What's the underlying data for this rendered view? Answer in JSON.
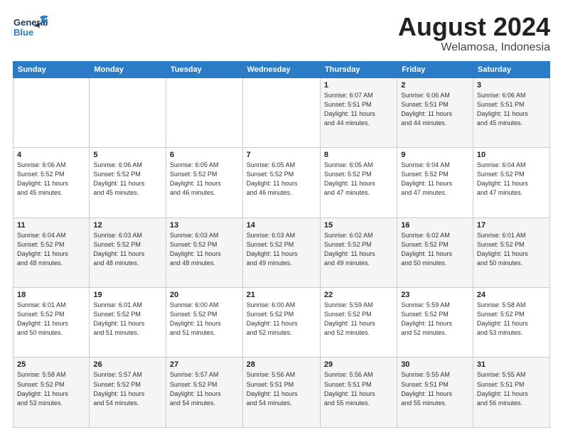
{
  "header": {
    "logo_line1": "General",
    "logo_line2": "Blue",
    "month": "August 2024",
    "location": "Welamosa, Indonesia"
  },
  "weekdays": [
    "Sunday",
    "Monday",
    "Tuesday",
    "Wednesday",
    "Thursday",
    "Friday",
    "Saturday"
  ],
  "weeks": [
    [
      {
        "day": "",
        "info": ""
      },
      {
        "day": "",
        "info": ""
      },
      {
        "day": "",
        "info": ""
      },
      {
        "day": "",
        "info": ""
      },
      {
        "day": "1",
        "info": "Sunrise: 6:07 AM\nSunset: 5:51 PM\nDaylight: 11 hours\nand 44 minutes."
      },
      {
        "day": "2",
        "info": "Sunrise: 6:06 AM\nSunset: 5:51 PM\nDaylight: 11 hours\nand 44 minutes."
      },
      {
        "day": "3",
        "info": "Sunrise: 6:06 AM\nSunset: 5:51 PM\nDaylight: 11 hours\nand 45 minutes."
      }
    ],
    [
      {
        "day": "4",
        "info": "Sunrise: 6:06 AM\nSunset: 5:52 PM\nDaylight: 11 hours\nand 45 minutes."
      },
      {
        "day": "5",
        "info": "Sunrise: 6:06 AM\nSunset: 5:52 PM\nDaylight: 11 hours\nand 45 minutes."
      },
      {
        "day": "6",
        "info": "Sunrise: 6:05 AM\nSunset: 5:52 PM\nDaylight: 11 hours\nand 46 minutes."
      },
      {
        "day": "7",
        "info": "Sunrise: 6:05 AM\nSunset: 5:52 PM\nDaylight: 11 hours\nand 46 minutes."
      },
      {
        "day": "8",
        "info": "Sunrise: 6:05 AM\nSunset: 5:52 PM\nDaylight: 11 hours\nand 47 minutes."
      },
      {
        "day": "9",
        "info": "Sunrise: 6:04 AM\nSunset: 5:52 PM\nDaylight: 11 hours\nand 47 minutes."
      },
      {
        "day": "10",
        "info": "Sunrise: 6:04 AM\nSunset: 5:52 PM\nDaylight: 11 hours\nand 47 minutes."
      }
    ],
    [
      {
        "day": "11",
        "info": "Sunrise: 6:04 AM\nSunset: 5:52 PM\nDaylight: 11 hours\nand 48 minutes."
      },
      {
        "day": "12",
        "info": "Sunrise: 6:03 AM\nSunset: 5:52 PM\nDaylight: 11 hours\nand 48 minutes."
      },
      {
        "day": "13",
        "info": "Sunrise: 6:03 AM\nSunset: 5:52 PM\nDaylight: 11 hours\nand 48 minutes."
      },
      {
        "day": "14",
        "info": "Sunrise: 6:03 AM\nSunset: 5:52 PM\nDaylight: 11 hours\nand 49 minutes."
      },
      {
        "day": "15",
        "info": "Sunrise: 6:02 AM\nSunset: 5:52 PM\nDaylight: 11 hours\nand 49 minutes."
      },
      {
        "day": "16",
        "info": "Sunrise: 6:02 AM\nSunset: 5:52 PM\nDaylight: 11 hours\nand 50 minutes."
      },
      {
        "day": "17",
        "info": "Sunrise: 6:01 AM\nSunset: 5:52 PM\nDaylight: 11 hours\nand 50 minutes."
      }
    ],
    [
      {
        "day": "18",
        "info": "Sunrise: 6:01 AM\nSunset: 5:52 PM\nDaylight: 11 hours\nand 50 minutes."
      },
      {
        "day": "19",
        "info": "Sunrise: 6:01 AM\nSunset: 5:52 PM\nDaylight: 11 hours\nand 51 minutes."
      },
      {
        "day": "20",
        "info": "Sunrise: 6:00 AM\nSunset: 5:52 PM\nDaylight: 11 hours\nand 51 minutes."
      },
      {
        "day": "21",
        "info": "Sunrise: 6:00 AM\nSunset: 5:52 PM\nDaylight: 11 hours\nand 52 minutes."
      },
      {
        "day": "22",
        "info": "Sunrise: 5:59 AM\nSunset: 5:52 PM\nDaylight: 11 hours\nand 52 minutes."
      },
      {
        "day": "23",
        "info": "Sunrise: 5:59 AM\nSunset: 5:52 PM\nDaylight: 11 hours\nand 52 minutes."
      },
      {
        "day": "24",
        "info": "Sunrise: 5:58 AM\nSunset: 5:52 PM\nDaylight: 11 hours\nand 53 minutes."
      }
    ],
    [
      {
        "day": "25",
        "info": "Sunrise: 5:58 AM\nSunset: 5:52 PM\nDaylight: 11 hours\nand 53 minutes."
      },
      {
        "day": "26",
        "info": "Sunrise: 5:57 AM\nSunset: 5:52 PM\nDaylight: 11 hours\nand 54 minutes."
      },
      {
        "day": "27",
        "info": "Sunrise: 5:57 AM\nSunset: 5:52 PM\nDaylight: 11 hours\nand 54 minutes."
      },
      {
        "day": "28",
        "info": "Sunrise: 5:56 AM\nSunset: 5:51 PM\nDaylight: 11 hours\nand 54 minutes."
      },
      {
        "day": "29",
        "info": "Sunrise: 5:56 AM\nSunset: 5:51 PM\nDaylight: 11 hours\nand 55 minutes."
      },
      {
        "day": "30",
        "info": "Sunrise: 5:55 AM\nSunset: 5:51 PM\nDaylight: 11 hours\nand 55 minutes."
      },
      {
        "day": "31",
        "info": "Sunrise: 5:55 AM\nSunset: 5:51 PM\nDaylight: 11 hours\nand 56 minutes."
      }
    ]
  ]
}
